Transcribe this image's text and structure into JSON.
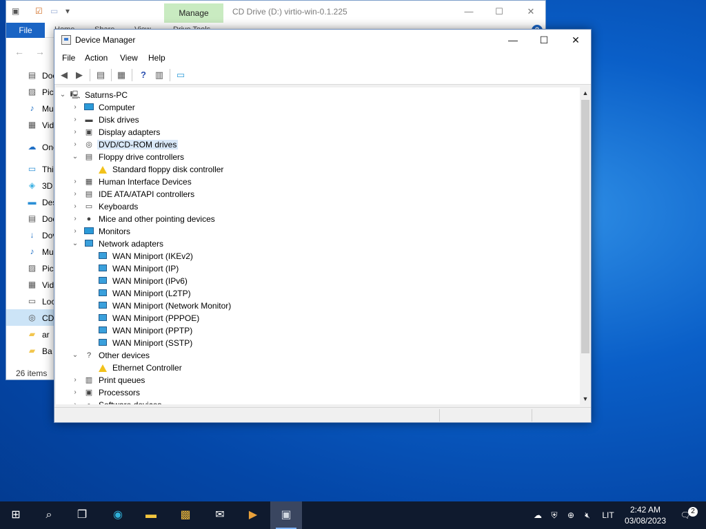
{
  "explorer": {
    "manage_tab": "Manage",
    "title": "CD Drive (D:) virtio-win-0.1.225",
    "file_tab": "File",
    "ribbon_tabs": [
      "Home",
      "Share",
      "View",
      "Drive Tools"
    ],
    "help": "?",
    "nav_items": [
      {
        "label": "Doc",
        "icon": "document-icon"
      },
      {
        "label": "Pict",
        "icon": "pictures-icon"
      },
      {
        "label": "Mu",
        "icon": "music-icon"
      },
      {
        "label": "Vid",
        "icon": "video-icon"
      },
      {
        "label": "OneD",
        "icon": "onedrive-icon"
      },
      {
        "label": "This",
        "icon": "this-pc-icon"
      },
      {
        "label": "3D",
        "icon": "3d-objects-icon"
      },
      {
        "label": "Des",
        "icon": "desktop-icon"
      },
      {
        "label": "Doc",
        "icon": "document-icon"
      },
      {
        "label": "Dov",
        "icon": "download-icon"
      },
      {
        "label": "Mu",
        "icon": "music-icon"
      },
      {
        "label": "Pict",
        "icon": "pictures-icon"
      },
      {
        "label": "Vid",
        "icon": "video-icon"
      },
      {
        "label": "Loc",
        "icon": "local-disk-icon"
      },
      {
        "label": "CD",
        "icon": "cd-drive-icon"
      },
      {
        "label": "ar",
        "icon": "folder-icon"
      },
      {
        "label": "Ba",
        "icon": "folder-icon"
      }
    ],
    "status": "26 items"
  },
  "devmgr": {
    "title": "Device Manager",
    "menu": [
      "File",
      "Action",
      "View",
      "Help"
    ],
    "tree": [
      {
        "label": "Saturns-PC",
        "level": 0,
        "state": "expanded",
        "icon": "computer-root-icon"
      },
      {
        "label": "Computer",
        "level": 1,
        "state": "collapsed",
        "icon": "computer-icon"
      },
      {
        "label": "Disk drives",
        "level": 1,
        "state": "collapsed",
        "icon": "disk-drive-icon"
      },
      {
        "label": "Display adapters",
        "level": 1,
        "state": "collapsed",
        "icon": "display-adapter-icon"
      },
      {
        "label": "DVD/CD-ROM drives",
        "level": 1,
        "state": "collapsed",
        "icon": "dvd-drive-icon",
        "selected": true
      },
      {
        "label": "Floppy drive controllers",
        "level": 1,
        "state": "expanded",
        "icon": "floppy-controller-icon"
      },
      {
        "label": "Standard floppy disk controller",
        "level": 2,
        "state": "leaf",
        "icon": "warning-device-icon"
      },
      {
        "label": "Human Interface Devices",
        "level": 1,
        "state": "collapsed",
        "icon": "hid-icon"
      },
      {
        "label": "IDE ATA/ATAPI controllers",
        "level": 1,
        "state": "collapsed",
        "icon": "ide-controller-icon"
      },
      {
        "label": "Keyboards",
        "level": 1,
        "state": "collapsed",
        "icon": "keyboard-icon"
      },
      {
        "label": "Mice and other pointing devices",
        "level": 1,
        "state": "collapsed",
        "icon": "mouse-icon"
      },
      {
        "label": "Monitors",
        "level": 1,
        "state": "collapsed",
        "icon": "monitor-icon"
      },
      {
        "label": "Network adapters",
        "level": 1,
        "state": "expanded",
        "icon": "network-adapter-icon"
      },
      {
        "label": "WAN Miniport (IKEv2)",
        "level": 2,
        "state": "leaf",
        "icon": "network-adapter-icon"
      },
      {
        "label": "WAN Miniport (IP)",
        "level": 2,
        "state": "leaf",
        "icon": "network-adapter-icon"
      },
      {
        "label": "WAN Miniport (IPv6)",
        "level": 2,
        "state": "leaf",
        "icon": "network-adapter-icon"
      },
      {
        "label": "WAN Miniport (L2TP)",
        "level": 2,
        "state": "leaf",
        "icon": "network-adapter-icon"
      },
      {
        "label": "WAN Miniport (Network Monitor)",
        "level": 2,
        "state": "leaf",
        "icon": "network-adapter-icon"
      },
      {
        "label": "WAN Miniport (PPPOE)",
        "level": 2,
        "state": "leaf",
        "icon": "network-adapter-icon"
      },
      {
        "label": "WAN Miniport (PPTP)",
        "level": 2,
        "state": "leaf",
        "icon": "network-adapter-icon"
      },
      {
        "label": "WAN Miniport (SSTP)",
        "level": 2,
        "state": "leaf",
        "icon": "network-adapter-icon"
      },
      {
        "label": "Other devices",
        "level": 1,
        "state": "expanded",
        "icon": "unknown-device-icon"
      },
      {
        "label": "Ethernet Controller",
        "level": 2,
        "state": "leaf",
        "icon": "warning-device-icon"
      },
      {
        "label": "Print queues",
        "level": 1,
        "state": "collapsed",
        "icon": "printer-icon"
      },
      {
        "label": "Processors",
        "level": 1,
        "state": "collapsed",
        "icon": "processor-icon"
      },
      {
        "label": "Software devices",
        "level": 1,
        "state": "collapsed",
        "icon": "software-device-icon"
      }
    ]
  },
  "taskbar": {
    "items": [
      "start-icon",
      "search-icon",
      "task-view-icon",
      "edge-icon",
      "file-explorer-icon",
      "store-icon",
      "mail-icon",
      "media-player-icon",
      "device-manager-icon"
    ],
    "language": "LIT",
    "time": "2:42 AM",
    "date": "03/08/2023",
    "notifications": "2"
  }
}
